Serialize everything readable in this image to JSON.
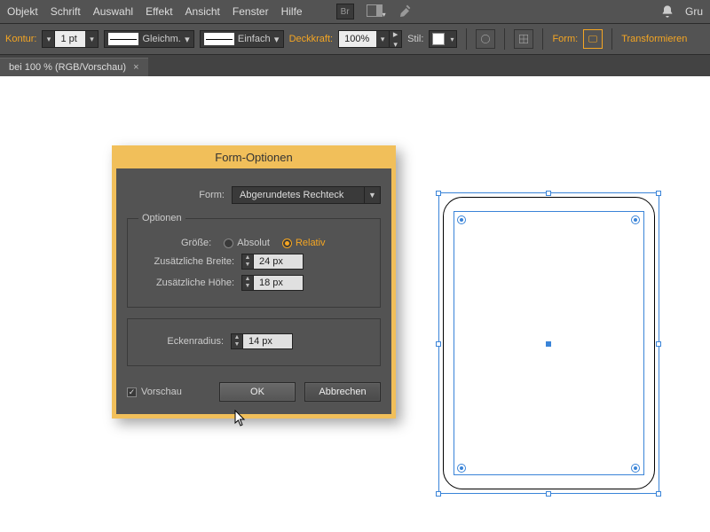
{
  "menubar": {
    "items": [
      "Objekt",
      "Schrift",
      "Auswahl",
      "Effekt",
      "Ansicht",
      "Fenster",
      "Hilfe"
    ],
    "bridge_label": "Br",
    "right_label": "Gru"
  },
  "optbar": {
    "stroke_label": "Kontur:",
    "stroke_value": "1 pt",
    "cap_label": "Gleichm.",
    "join_label": "Einfach",
    "opacity_label": "Deckkraft:",
    "opacity_value": "100%",
    "style_label": "Stil:",
    "shape_label": "Form:",
    "transform_label": "Transformieren"
  },
  "tab": {
    "title": "bei 100 % (RGB/Vorschau)",
    "close": "×"
  },
  "dialog": {
    "title": "Form-Optionen",
    "shape_label": "Form:",
    "shape_value": "Abgerundetes Rechteck",
    "options_legend": "Optionen",
    "size_label": "Größe:",
    "size_abs": "Absolut",
    "size_rel": "Relativ",
    "extra_width_label": "Zusätzliche Breite:",
    "extra_width_value": "24 px",
    "extra_height_label": "Zusätzliche Höhe:",
    "extra_height_value": "18 px",
    "corner_radius_label": "Eckenradius:",
    "corner_radius_value": "14 px",
    "preview_label": "Vorschau",
    "ok": "OK",
    "cancel": "Abbrechen"
  },
  "colors": {
    "accent": "#f5a623",
    "dialog_frame": "#f1bf5a",
    "selection": "#3a84d8"
  }
}
